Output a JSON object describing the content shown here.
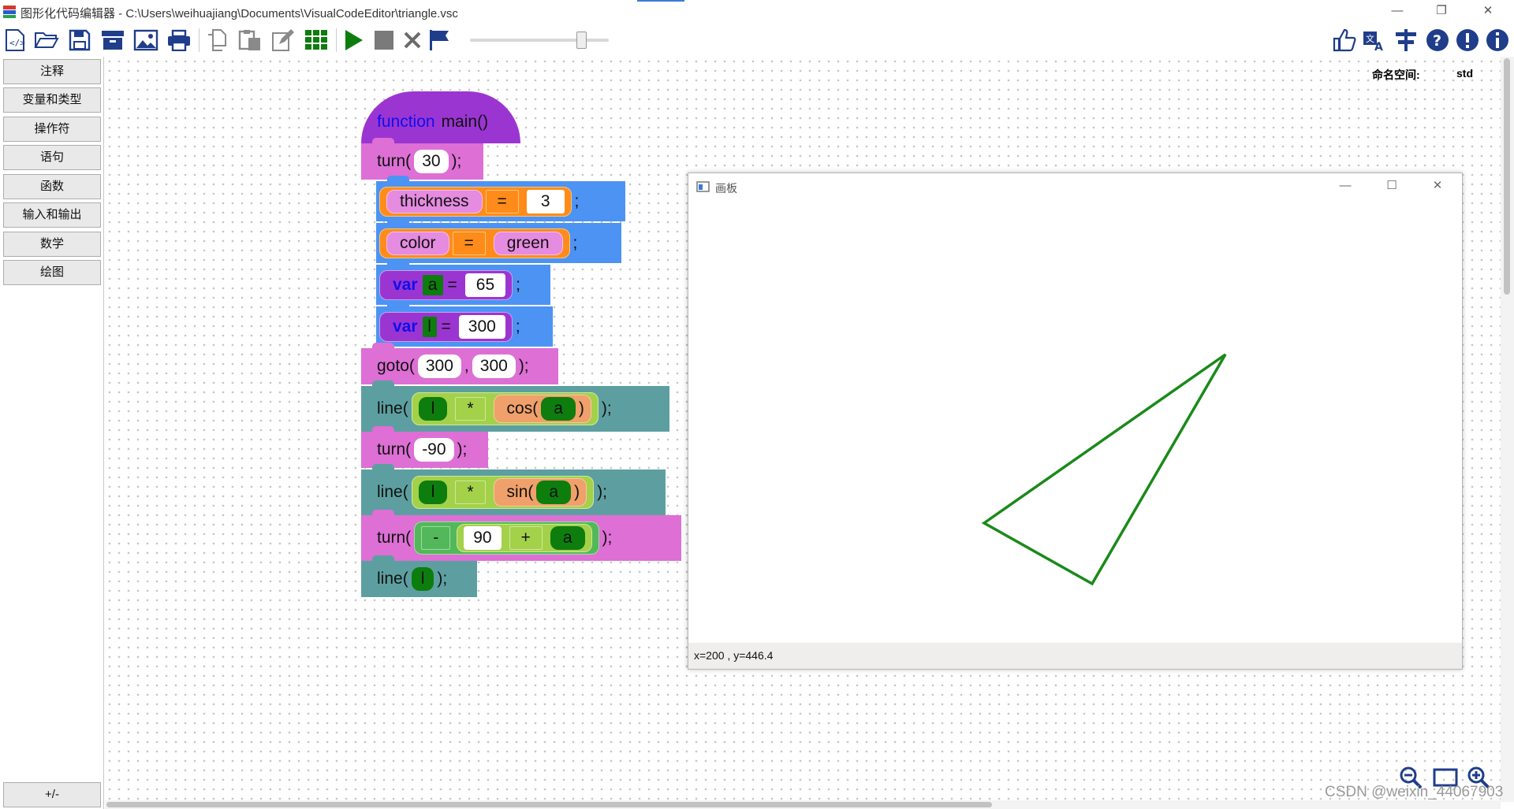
{
  "window": {
    "title": "图形化代码编辑器 - C:\\Users\\weihuajiang\\Documents\\VisualCodeEditor\\triangle.vsc",
    "controls": [
      "—",
      "❐",
      "✕"
    ]
  },
  "toolbar": {
    "left_icons": [
      "new-code-icon",
      "open-folder-icon",
      "save-icon",
      "archive-icon",
      "image-icon",
      "print-icon",
      "copy-icon",
      "paste-icon",
      "edit-icon",
      "grid-apps-icon",
      "run-icon",
      "stop-icon",
      "close-x-icon",
      "flag-icon"
    ],
    "speed_slider_level": 0.8,
    "right_icons": [
      "thumbs-up-icon",
      "translate-icon",
      "align-icon",
      "help-icon",
      "alert-icon",
      "info-icon"
    ]
  },
  "categories": [
    "注释",
    "变量和类型",
    "操作符",
    "语句",
    "函数",
    "输入和输出",
    "数学",
    "绘图"
  ],
  "bottom_toggle": "+/-",
  "namespace": {
    "label": "命名空间:",
    "value": "std"
  },
  "code": {
    "fn_keyword": "function",
    "fn_name": "main()",
    "turn1": {
      "fn": "turn(",
      "arg": "30",
      "end": ");"
    },
    "assign1": {
      "lhs": "thickness",
      "op": "=",
      "rhs": "3",
      "end": ";"
    },
    "assign2": {
      "lhs": "color",
      "op": "=",
      "rhs": "green",
      "end": ";"
    },
    "var1": {
      "kw": "var",
      "name": "a",
      "op": "=",
      "val": "65",
      "end": ";"
    },
    "var2": {
      "kw": "var",
      "name": "l",
      "op": "=",
      "val": "300",
      "end": ";"
    },
    "goto": {
      "fn": "goto(",
      "x": "300",
      "comma": ",",
      "y": "300",
      "end": ");"
    },
    "line1": {
      "fn": "line(",
      "a": "l",
      "op": "*",
      "f": "cos(",
      "arg": "a",
      "close": ")",
      "end": ");"
    },
    "turn2": {
      "fn": "turn(",
      "arg": "-90",
      "end": ");"
    },
    "line2": {
      "fn": "line(",
      "a": "l",
      "op": "*",
      "f": "sin(",
      "arg": "a",
      "close": ")",
      "end": ");"
    },
    "turn3": {
      "fn": "turn(",
      "neg": "-",
      "n": "90",
      "op": "+",
      "arg": "a",
      "end": ");"
    },
    "line3": {
      "fn": "line(",
      "arg": "l",
      "end": ");"
    }
  },
  "board": {
    "title": "画板",
    "status": "x=200 , y=446.4",
    "stroke_color": "#1a8a1a",
    "controls": [
      "—",
      "☐",
      "✕"
    ]
  },
  "zoom_icons": [
    "zoom-out-icon",
    "fit-screen-icon",
    "zoom-in-icon"
  ],
  "watermark": "CSDN @weixin_44067903",
  "colors": {
    "function_header": "#9b35d2",
    "call_block": "#dd6fd5",
    "assign_block": "#4c93f4",
    "line_block": "#5d9fa0",
    "operator_pill": "#ff8c1a",
    "var_green": "#0d7d0d"
  }
}
